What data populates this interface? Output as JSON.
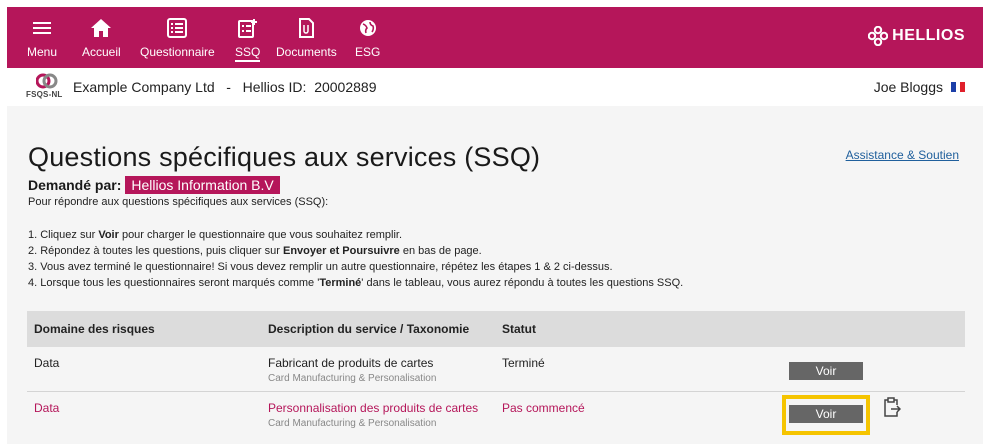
{
  "nav": {
    "items": [
      {
        "label": "Menu",
        "icon": "hamburger-icon"
      },
      {
        "label": "Accueil",
        "icon": "home-icon"
      },
      {
        "label": "Questionnaire",
        "icon": "list-icon"
      },
      {
        "label": "SSQ",
        "icon": "ssq-icon",
        "active": true
      },
      {
        "label": "Documents",
        "icon": "documents-icon"
      },
      {
        "label": "ESG",
        "icon": "globe-icon"
      }
    ],
    "brand": "HELLIOS"
  },
  "company_bar": {
    "logo_text": "FSQS-NL",
    "company": "Example Company Ltd   -   Hellios ID:  20002889",
    "user": "Joe Bloggs"
  },
  "page": {
    "title": "Questions spécifiques aux services (SSQ)",
    "help_link": "Assistance & Soutien",
    "requested_label": "Demandé par:",
    "requested_org": "Hellios Information B.V",
    "intro": "Pour répondre aux questions spécifiques aux services (SSQ):",
    "steps": [
      {
        "pre": "1. Cliquez sur ",
        "bold": "Voir",
        "post": " pour charger le questionnaire que vous souhaitez remplir."
      },
      {
        "pre": "2. Répondez à toutes les questions, puis cliquer sur ",
        "bold": "Envoyer et Poursuivre",
        "post": " en bas de page."
      },
      {
        "pre": "3. Vous avez terminé le questionnaire! Si vous devez remplir un autre questionnaire, répétez les étapes 1 & 2 ci-dessus.",
        "bold": "",
        "post": ""
      },
      {
        "pre": "4. Lorsque tous les questionnaires seront marqués comme '",
        "bold": "Terminé",
        "post": "' dans le tableau, vous aurez répondu à toutes les questions SSQ."
      }
    ]
  },
  "table": {
    "headers": [
      "Domaine des risques",
      "Description du service / Taxonomie",
      "Statut"
    ],
    "rows": [
      {
        "domain": "Data",
        "description": "Fabricant de produits de cartes",
        "taxonomy": "Card Manufacturing & Personalisation",
        "status": "Terminé",
        "button": "Voir"
      },
      {
        "domain": "Data",
        "description": "Personnalisation des produits de cartes",
        "taxonomy": "Card Manufacturing & Personalisation",
        "status": "Pas commencé",
        "button": "Voir"
      }
    ]
  },
  "colors": {
    "brand": "#b5165a",
    "highlight": "#f5c400",
    "button": "#666666"
  }
}
